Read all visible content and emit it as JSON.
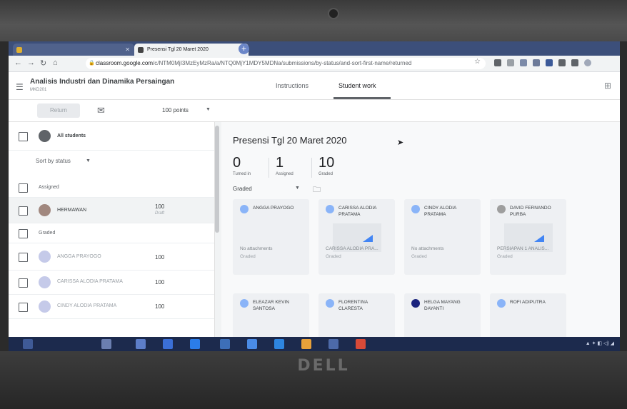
{
  "browser": {
    "tabs": [
      {
        "label": "",
        "active": false
      },
      {
        "label": "Presensi Tgl 20 Maret 2020",
        "active": true
      }
    ],
    "new_tab_label": "+",
    "url_host": "classroom.google.com",
    "url_path": "/c/NTM0MjI3MzEyMzRa/a/NTQ0MjY1MDY5MDNa/submissions/by-status/and-sort-first-name/returned"
  },
  "header": {
    "course_title": "Analisis Industri dan Dinamika Persaingan",
    "course_code": "MKD201",
    "tabs": [
      "Instructions",
      "Student work"
    ],
    "active_tab": "Student work"
  },
  "actions": {
    "return_label": "Return",
    "points": "100 points"
  },
  "roster": {
    "all_students": "All students",
    "sort_label": "Sort by status",
    "sections": {
      "assigned": "Assigned",
      "graded": "Graded"
    },
    "assigned_rows": [
      {
        "name": "HERMAWAN",
        "grade": "100",
        "sub": "Draft"
      }
    ],
    "graded_rows": [
      {
        "name": "ANGGA PRAYOGO",
        "grade": "100"
      },
      {
        "name": "CARISSA ALODIA PRATAMA",
        "grade": "100"
      },
      {
        "name": "CINDY ALODIA PRATAMA",
        "grade": "100"
      }
    ]
  },
  "assignment": {
    "title": "Presensi Tgl 20 Maret 2020",
    "stats": [
      {
        "value": "0",
        "label": "Turned in"
      },
      {
        "value": "1",
        "label": "Assigned"
      },
      {
        "value": "10",
        "label": "Graded"
      }
    ],
    "filter": "Graded",
    "cards": [
      {
        "name": "ANGGA PRAYOGO",
        "attachment": "No attachments",
        "status": "Graded",
        "avatar_color": "#8ab4f8",
        "doc": false
      },
      {
        "name": "CARISSA ALODIA PRATAMA",
        "attachment": "CARISSA ALODIA PRA...",
        "status": "Graded",
        "avatar_color": "#8ab4f8",
        "doc": true
      },
      {
        "name": "CINDY ALODIA PRATAMA",
        "attachment": "No attachments",
        "status": "Graded",
        "avatar_color": "#8ab4f8",
        "doc": false
      },
      {
        "name": "DAVID FERNANDO PURBA",
        "attachment": "PERSIAPAN 1 ANALIS...",
        "status": "Graded",
        "avatar_color": "#9e9e9e",
        "doc": true
      },
      {
        "name": "ELEAZAR KEVIN SANTOSA",
        "attachment": "",
        "status": "",
        "avatar_color": "#8ab4f8",
        "doc": false
      },
      {
        "name": "FLORENTINA CLARESTA",
        "attachment": "",
        "status": "",
        "avatar_color": "#8ab4f8",
        "doc": false
      },
      {
        "name": "HELGA MAYANG DAYANTI",
        "attachment": "",
        "status": "",
        "avatar_color": "#1a237e",
        "doc": false
      },
      {
        "name": "ROFI ADIPUTRA",
        "attachment": "",
        "status": "",
        "avatar_color": "#8ab4f8",
        "doc": false
      }
    ]
  },
  "monitor": {
    "brand": "DELL"
  },
  "colors": {
    "accent": "#4285f4",
    "taskbar": "#1c2a4d"
  }
}
